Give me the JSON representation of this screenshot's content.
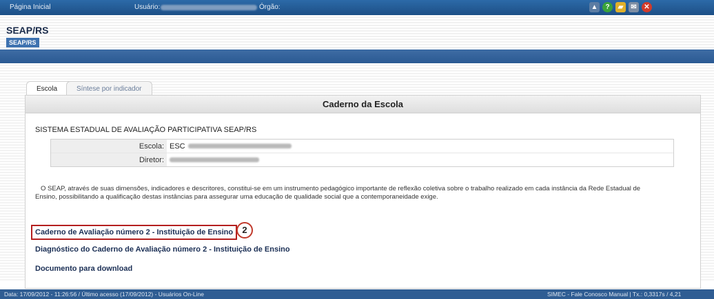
{
  "topbar": {
    "home": "Página Inicial",
    "user_label": "Usuário:",
    "org_label": "Órgão:",
    "icons": [
      {
        "name": "printer-icon",
        "glyph": "▲",
        "color": "#5b7ca3"
      },
      {
        "name": "help-icon",
        "glyph": "?",
        "color": "#3aa33a"
      },
      {
        "name": "folder-icon",
        "glyph": "▰",
        "color": "#e0b02a"
      },
      {
        "name": "mail-icon",
        "glyph": "✉",
        "color": "#7d8da3"
      },
      {
        "name": "close-icon",
        "glyph": "✕",
        "color": "#d23a2a"
      }
    ]
  },
  "header": {
    "title": "SEAP/RS",
    "subtitle": "SEAP/RS"
  },
  "tabs": {
    "escola": "Escola",
    "sintese": "Síntese por indicador"
  },
  "panel": {
    "title": "Caderno da Escola",
    "heading": "SISTEMA ESTADUAL DE AVALIAÇÃO PARTICIPATIVA   SEAP/RS",
    "escola_label": "Escola:",
    "escola_value": "ESC",
    "diretor_label": "Diretor:",
    "description": "O SEAP, através de suas dimensões, indicadores e descritores, constitui-se em um instrumento pedagógico importante de reflexão coletiva sobre o trabalho realizado em cada instância da Rede Estadual de Ensino, possibilitando a qualificação destas instâncias para assegurar uma educação de qualidade social que a contemporaneidade exige.",
    "link1": "Caderno de Avaliação número 2 - Instituição de Ensino",
    "marker": "2",
    "link2": "Diagnóstico do Caderno de Avaliação número 2 - Instituição de Ensino",
    "link3": "Documento para download"
  },
  "footer": {
    "left": "Data: 17/09/2012 - 11:26:56 / Último acesso (17/09/2012) - Usuários On-Line",
    "right": "SIMEC - Fale Conosco    Manual    | Tx.: 0,3317s / 4,21"
  }
}
